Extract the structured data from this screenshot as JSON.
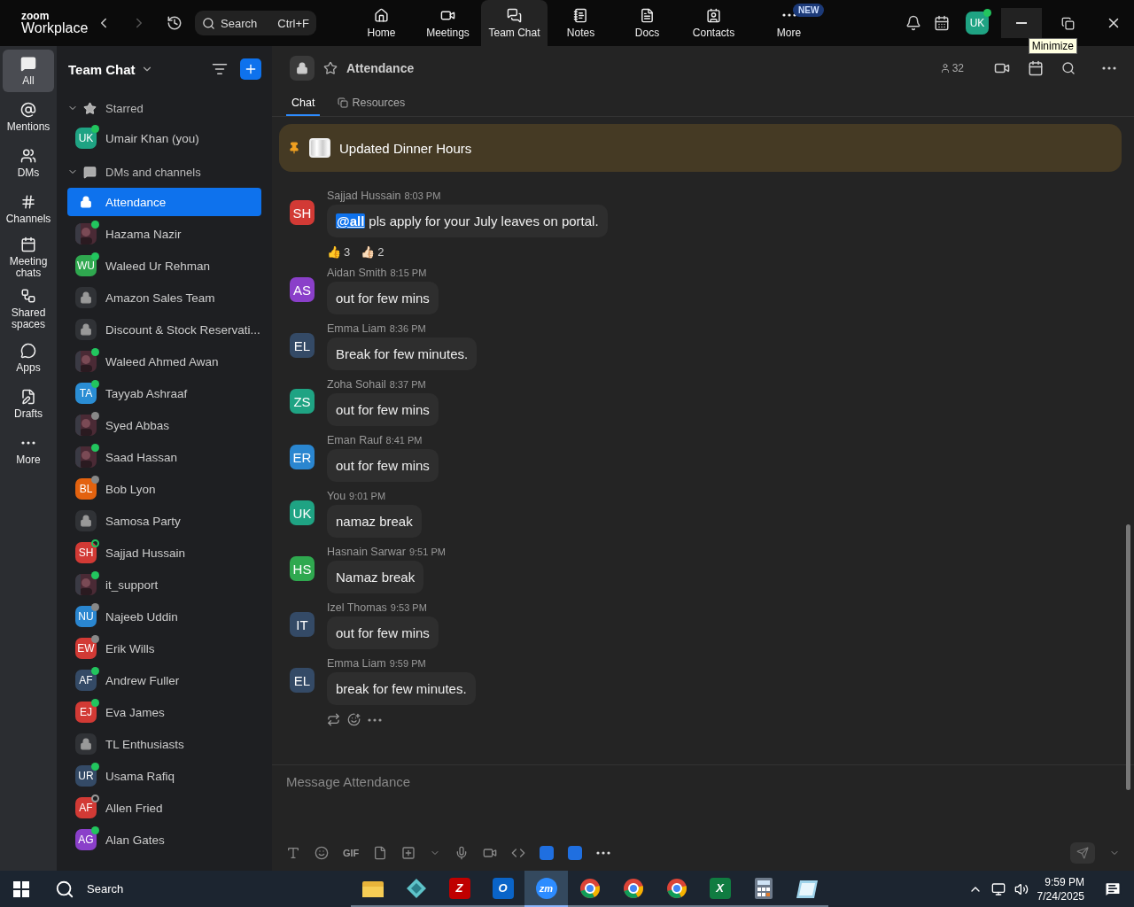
{
  "app": {
    "brand_top": "zoom",
    "brand_bottom": "Workplace",
    "search": {
      "placeholder": "Search",
      "shortcut": "Ctrl+F"
    }
  },
  "nav": [
    {
      "label": "Home",
      "kind": "home",
      "selected": false
    },
    {
      "label": "Meetings",
      "kind": "meetings",
      "selected": false
    },
    {
      "label": "Team Chat",
      "kind": "chat",
      "selected": true
    },
    {
      "label": "Notes",
      "kind": "notes",
      "selected": false
    },
    {
      "label": "Docs",
      "kind": "docs",
      "selected": false
    },
    {
      "label": "Contacts",
      "kind": "contacts",
      "selected": false
    },
    {
      "label": "More",
      "kind": "more",
      "selected": false,
      "badge": "NEW"
    }
  ],
  "user": {
    "initials": "UK",
    "presence": {
      "kind": "online"
    }
  },
  "tooltip": "Minimize",
  "rail": [
    {
      "label": "All",
      "kind": "all",
      "selected": true
    },
    {
      "label": "Mentions",
      "kind": "mentions",
      "selected": false
    },
    {
      "label": "DMs",
      "kind": "dms",
      "selected": false
    },
    {
      "label": "Channels",
      "kind": "channels",
      "selected": false
    },
    {
      "label": "Meeting chats",
      "kind": "meetings",
      "selected": false
    },
    {
      "label": "Shared spaces",
      "kind": "shared",
      "selected": false
    },
    {
      "label": "Apps",
      "kind": "apps",
      "selected": false
    },
    {
      "label": "Drafts",
      "kind": "drafts",
      "selected": false
    },
    {
      "label": "More",
      "kind": "more",
      "selected": false
    }
  ],
  "sidebar": {
    "title": "Team Chat",
    "sections": [
      {
        "title": "Starred",
        "kind": "starred",
        "expanded": true,
        "items": [
          {
            "name": "Umair Khan (you)",
            "avatar": {
              "kind": "initials",
              "initials": "UK",
              "color": "#1fa383"
            },
            "presence": {
              "kind": "online"
            },
            "selected": false
          }
        ]
      },
      {
        "title": "DMs and channels",
        "kind": "dms",
        "expanded": true,
        "items": [
          {
            "name": "Attendance",
            "avatar": {
              "kind": "lock"
            },
            "selected": true
          },
          {
            "name": "Hazama Nazir",
            "presence": {
              "kind": "online"
            },
            "selected": false
          },
          {
            "name": "Waleed Ur Rehman",
            "avatar": {
              "kind": "initials",
              "initials": "WU",
              "color": "#2fa84f"
            },
            "presence": {
              "kind": "online"
            },
            "selected": false
          },
          {
            "name": "Amazon Sales Team",
            "avatar": {
              "kind": "lock"
            },
            "selected": false
          },
          {
            "name": "Discount & Stock Reservati...",
            "avatar": {
              "kind": "lock"
            },
            "selected": false
          },
          {
            "name": "Waleed Ahmed Awan",
            "presence": {
              "kind": "online"
            },
            "selected": false
          },
          {
            "name": "Tayyab Ashraaf",
            "avatar": {
              "kind": "initials",
              "initials": "TA",
              "color": "#2a8dd4"
            },
            "presence": {
              "kind": "online"
            },
            "selected": false
          },
          {
            "name": "Syed Abbas",
            "presence": {
              "kind": "away"
            },
            "selected": false
          },
          {
            "name": "Saad Hassan",
            "presence": {
              "kind": "online"
            },
            "selected": false
          },
          {
            "name": "Bob Lyon",
            "avatar": {
              "kind": "initials",
              "initials": "BL",
              "color": "#e3620f"
            },
            "presence": {
              "kind": "away"
            },
            "selected": false
          },
          {
            "name": "Samosa Party",
            "avatar": {
              "kind": "lock"
            },
            "selected": false
          },
          {
            "name": "Sajjad Hussain",
            "avatar": {
              "kind": "initials",
              "initials": "SH",
              "color": "#d23a35"
            },
            "presence": {
              "kind": "mobile"
            },
            "selected": false
          },
          {
            "name": "it_support",
            "presence": {
              "kind": "online"
            },
            "selected": false
          },
          {
            "name": "Najeeb Uddin",
            "avatar": {
              "kind": "initials",
              "initials": "NU",
              "color": "#2a86d0"
            },
            "presence": {
              "kind": "away"
            },
            "selected": false
          },
          {
            "name": "Erik Wills",
            "avatar": {
              "kind": "initials",
              "initials": "EW",
              "color": "#d23a35"
            },
            "presence": {
              "kind": "away"
            },
            "selected": false
          },
          {
            "name": "Andrew Fuller",
            "avatar": {
              "kind": "initials",
              "initials": "AF",
              "color": "#344a66"
            },
            "presence": {
              "kind": "online"
            },
            "selected": false
          },
          {
            "name": "Eva James",
            "avatar": {
              "kind": "initials",
              "initials": "EJ",
              "color": "#d23a35"
            },
            "presence": {
              "kind": "online"
            },
            "selected": false
          },
          {
            "name": "TL Enthusiasts",
            "avatar": {
              "kind": "lock"
            },
            "selected": false
          },
          {
            "name": "Usama Rafiq",
            "avatar": {
              "kind": "initials",
              "initials": "UR",
              "color": "#344a66"
            },
            "presence": {
              "kind": "online"
            },
            "selected": false
          },
          {
            "name": "Allen Fried",
            "avatar": {
              "kind": "initials",
              "initials": "AF",
              "color": "#d23a35"
            },
            "presence": {
              "kind": "offline"
            },
            "selected": false
          },
          {
            "name": "Alan Gates",
            "avatar": {
              "kind": "initials",
              "initials": "AG",
              "color": "#8a3fc9"
            },
            "presence": {
              "kind": "online"
            },
            "selected": false
          }
        ]
      }
    ]
  },
  "channel": {
    "name": "Attendance",
    "members": "32",
    "tabs": [
      {
        "label": "Chat",
        "selected": true
      },
      {
        "label": "Resources",
        "selected": false
      }
    ],
    "pinned": "Updated Dinner Hours",
    "messages": [
      {
        "sender": "Sajjad Hussain",
        "time": "8:03 PM",
        "initials": "SH",
        "color": "#d23a35",
        "mention": "@all",
        "text": "pls apply for your July leaves on portal.",
        "reactions": [
          {
            "emoji": "👍",
            "count": "3"
          },
          {
            "emoji": "👍🏻",
            "count": "2"
          }
        ]
      },
      {
        "sender": "Aidan Smith",
        "time": "8:15 PM",
        "initials": "AS",
        "color": "#8a3fc9",
        "text": "out for few mins"
      },
      {
        "sender": "Emma Liam",
        "time": "8:36 PM",
        "initials": "EL",
        "color": "#344a66",
        "text": "Break for few minutes."
      },
      {
        "sender": "Zoha Sohail",
        "time": "8:37 PM",
        "initials": "ZS",
        "color": "#1fa383",
        "text": "out for few mins"
      },
      {
        "sender": "Eman Rauf",
        "time": "8:41 PM",
        "initials": "ER",
        "color": "#2a86d0",
        "text": "out for few mins"
      },
      {
        "sender": "You",
        "time": "9:01 PM",
        "initials": "UK",
        "color": "#1fa383",
        "text": "namaz break"
      },
      {
        "sender": "Hasnain Sarwar",
        "time": "9:51 PM",
        "initials": "HS",
        "color": "#2fa84f",
        "text": "Namaz break"
      },
      {
        "sender": "Izel Thomas",
        "time": "9:53 PM",
        "initials": "IT",
        "color": "#344a66",
        "text": "out for few mins"
      },
      {
        "sender": "Emma Liam",
        "time": "9:59 PM",
        "initials": "EL",
        "color": "#344a66",
        "text": "break for few minutes.",
        "actions": true
      }
    ],
    "composer": {
      "placeholder": "Message Attendance",
      "gif": "GIF"
    }
  },
  "taskbar": {
    "search": "Search",
    "time": "9:59 PM",
    "date": "7/24/2025",
    "apps": [
      {
        "kind": "folder",
        "selected": false
      },
      {
        "kind": "gem",
        "selected": false
      },
      {
        "kind": "filezilla",
        "label": "Z",
        "selected": false
      },
      {
        "kind": "outlook",
        "label": "O",
        "selected": false
      },
      {
        "kind": "zoom",
        "label": "zm",
        "selected": true
      },
      {
        "kind": "chrome",
        "selected": false
      },
      {
        "kind": "chrome",
        "selected": false
      },
      {
        "kind": "chrome",
        "selected": false
      },
      {
        "kind": "excel",
        "label": "X",
        "selected": false
      },
      {
        "kind": "calculator",
        "selected": false
      },
      {
        "kind": "notepad",
        "selected": false
      }
    ]
  }
}
